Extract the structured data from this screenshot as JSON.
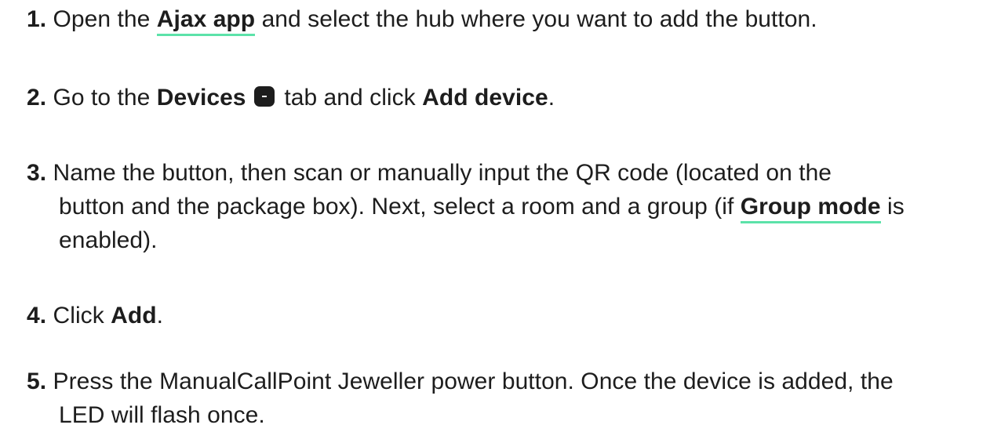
{
  "steps": [
    {
      "number": "1.",
      "parts": {
        "t1": "Open the ",
        "link": "Ajax app",
        "t2": " and select the hub where you want to add the button."
      }
    },
    {
      "number": "2.",
      "parts": {
        "t1": "Go to the ",
        "b1": "Devices",
        "icon": "devices-tab-icon",
        "t2": " tab and click ",
        "b2": "Add device",
        "t3": "."
      }
    },
    {
      "number": "3.",
      "parts": {
        "t1": "Name the button, then scan or manually input the QR code (located on the",
        "t2": "button and the package box). Next, select a room and a group (if ",
        "link": "Group mode",
        "t3": " is",
        "t4": "enabled)."
      }
    },
    {
      "number": "4.",
      "parts": {
        "t1": "Click ",
        "b1": "Add",
        "t2": "."
      }
    },
    {
      "number": "5.",
      "parts": {
        "t1": "Press the ManualCallPoint Jeweller power button. Once the device is added, the",
        "t2": "LED will flash once."
      }
    }
  ],
  "colors": {
    "text": "#1d1d1d",
    "link_underline": "#5ce2a9"
  }
}
